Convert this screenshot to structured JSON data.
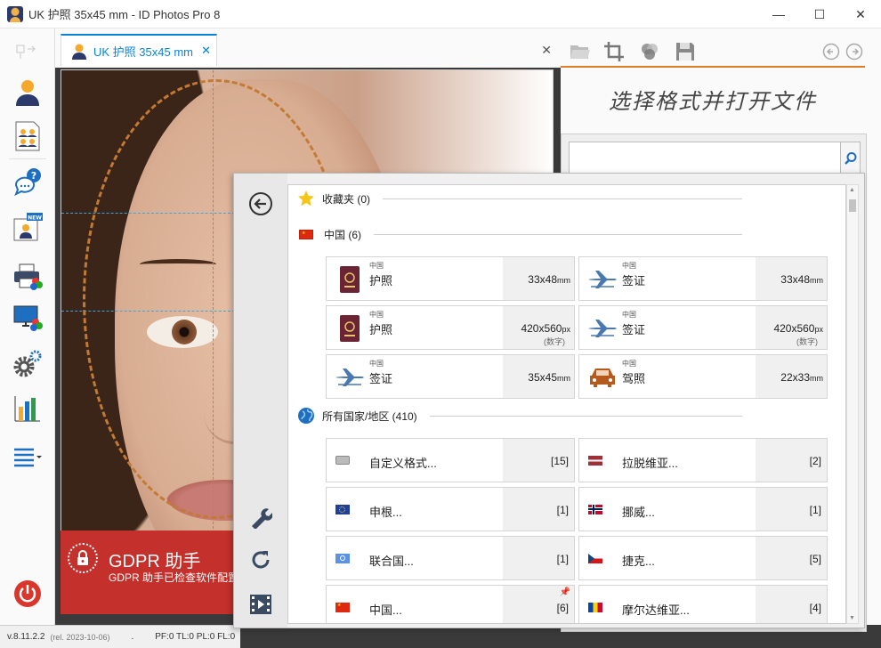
{
  "window": {
    "title": "UK 护照 35x45 mm - ID Photos Pro 8",
    "minimize": "—",
    "maximize": "☐",
    "close": "✕"
  },
  "tab": {
    "label": "UK 护照 35x45 mm",
    "close": "✕"
  },
  "strip_close": "✕",
  "gdpr": {
    "title": "GDPR 助手",
    "subtitle": "GDPR 助手已检查软件配置"
  },
  "status": {
    "version": "v.8.11.2.2",
    "release": "(rel. 2023-10-06)",
    "dot": ".",
    "flags": "PF:0 TL:0 PL:0 FL:0"
  },
  "right_panel": {
    "title": "选择格式并打开文件",
    "search_placeholder": ""
  },
  "sections": {
    "favorites": {
      "label": "收藏夹 (0)"
    },
    "china": {
      "label": "中国 (6)"
    },
    "all": {
      "label": "所有国家/地区 (410)"
    }
  },
  "formats": [
    {
      "country": "中国",
      "name": "护照",
      "size": "33x48",
      "unit": "mm",
      "note": "",
      "icon": "passport-icon"
    },
    {
      "country": "中国",
      "name": "签证",
      "size": "33x48",
      "unit": "mm",
      "note": "",
      "icon": "airplane-icon"
    },
    {
      "country": "中国",
      "name": "护照",
      "size": "420x560",
      "unit": "px",
      "note": "(数字)",
      "icon": "passport-icon"
    },
    {
      "country": "中国",
      "name": "签证",
      "size": "420x560",
      "unit": "px",
      "note": "(数字)",
      "icon": "airplane-icon"
    },
    {
      "country": "中国",
      "name": "签证",
      "size": "35x45",
      "unit": "mm",
      "note": "",
      "icon": "airplane-icon"
    },
    {
      "country": "中国",
      "name": "驾照",
      "size": "22x33",
      "unit": "mm",
      "note": "",
      "icon": "car-icon"
    }
  ],
  "countries": [
    {
      "name": "自定义格式...",
      "count": "[15]",
      "flag": "custom"
    },
    {
      "name": "拉脱维亚...",
      "count": "[2]",
      "flag": "latvia"
    },
    {
      "name": "申根...",
      "count": "[1]",
      "flag": "eu"
    },
    {
      "name": "挪威...",
      "count": "[1]",
      "flag": "norway"
    },
    {
      "name": "联合国...",
      "count": "[1]",
      "flag": "un"
    },
    {
      "name": "捷克...",
      "count": "[5]",
      "flag": "czech"
    },
    {
      "name": "中国...",
      "count": "[6]",
      "flag": "china",
      "pinned": true
    },
    {
      "name": "摩尔达维亚...",
      "count": "[4]",
      "flag": "moldova"
    }
  ],
  "colors": {
    "accent_blue": "#0a84d6",
    "accent_orange": "#e07b28",
    "gdpr_red": "#c4302b"
  }
}
